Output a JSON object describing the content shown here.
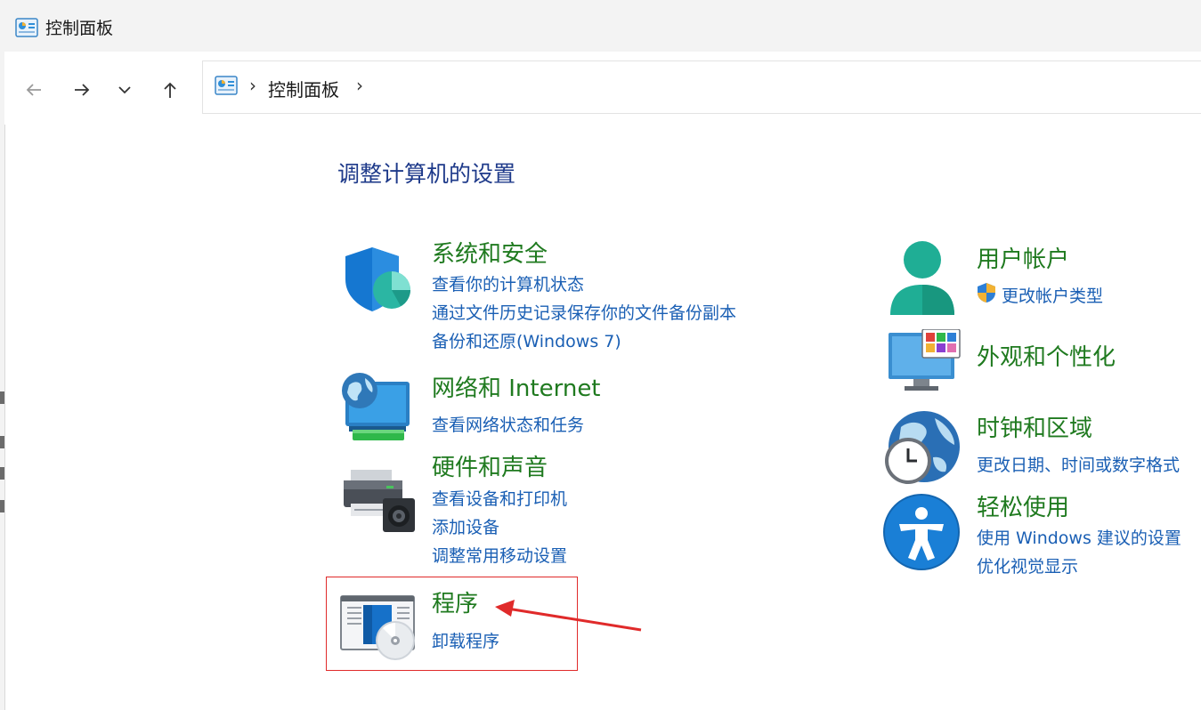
{
  "window": {
    "title": "控制面板"
  },
  "address": {
    "crumb": "控制面板"
  },
  "nav": {
    "back": "back-arrow-icon",
    "forward": "forward-arrow-icon",
    "recent": "chevron-down-icon",
    "up": "up-arrow-icon"
  },
  "heading": "调整计算机的设置",
  "left_categories": [
    {
      "title": "系统和安全",
      "links": [
        "查看你的计算机状态",
        "通过文件历史记录保存你的文件备份副本",
        "备份和还原(Windows 7)"
      ]
    },
    {
      "title": "网络和 Internet",
      "links": [
        "查看网络状态和任务"
      ]
    },
    {
      "title": "硬件和声音",
      "links": [
        "查看设备和打印机",
        "添加设备",
        "调整常用移动设置"
      ]
    },
    {
      "title": "程序",
      "links": [
        "卸载程序"
      ]
    }
  ],
  "right_categories": [
    {
      "title": "用户帐户",
      "links": [
        "更改帐户类型"
      ]
    },
    {
      "title": "外观和个性化",
      "links": []
    },
    {
      "title": "时钟和区域",
      "links": [
        "更改日期、时间或数字格式"
      ]
    },
    {
      "title": "轻松使用",
      "links": [
        "使用 Windows 建议的设置",
        "优化视觉显示"
      ]
    }
  ],
  "colors": {
    "heading": "#1e3a8a",
    "category_title": "#1f7a1f",
    "link": "#1a5fb4",
    "annotation": "#e02a2a"
  }
}
